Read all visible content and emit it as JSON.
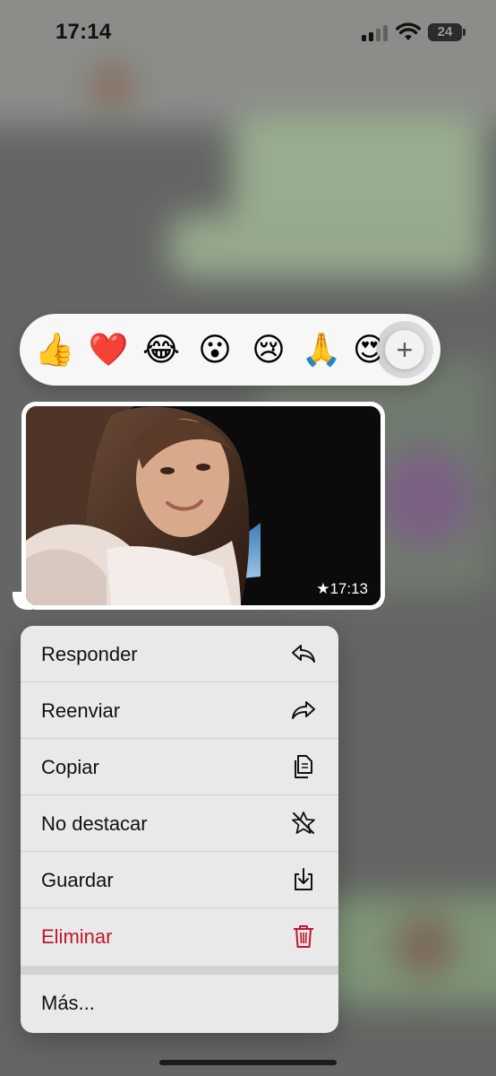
{
  "status_bar": {
    "time": "17:14",
    "battery": "24"
  },
  "reactions": [
    {
      "emoji": "👍",
      "name": "thumbs-up-emoji"
    },
    {
      "emoji": "❤️",
      "name": "heart-emoji"
    },
    {
      "emoji": "😂",
      "name": "laughing-emoji"
    },
    {
      "emoji": "😮",
      "name": "surprised-emoji"
    },
    {
      "emoji": "😢",
      "name": "crying-emoji"
    },
    {
      "emoji": "🙏",
      "name": "praying-hands-emoji"
    },
    {
      "emoji": "😍",
      "name": "heart-eyes-emoji"
    }
  ],
  "add_reaction_symbol": "+",
  "message": {
    "time": "★17:13"
  },
  "menu": {
    "reply": "Responder",
    "forward": "Reenviar",
    "copy": "Copiar",
    "unstar": "No destacar",
    "save": "Guardar",
    "delete": "Eliminar",
    "more": "Más..."
  },
  "colors": {
    "danger": "#c1162d",
    "menu_bg": "#e9e9ea"
  }
}
